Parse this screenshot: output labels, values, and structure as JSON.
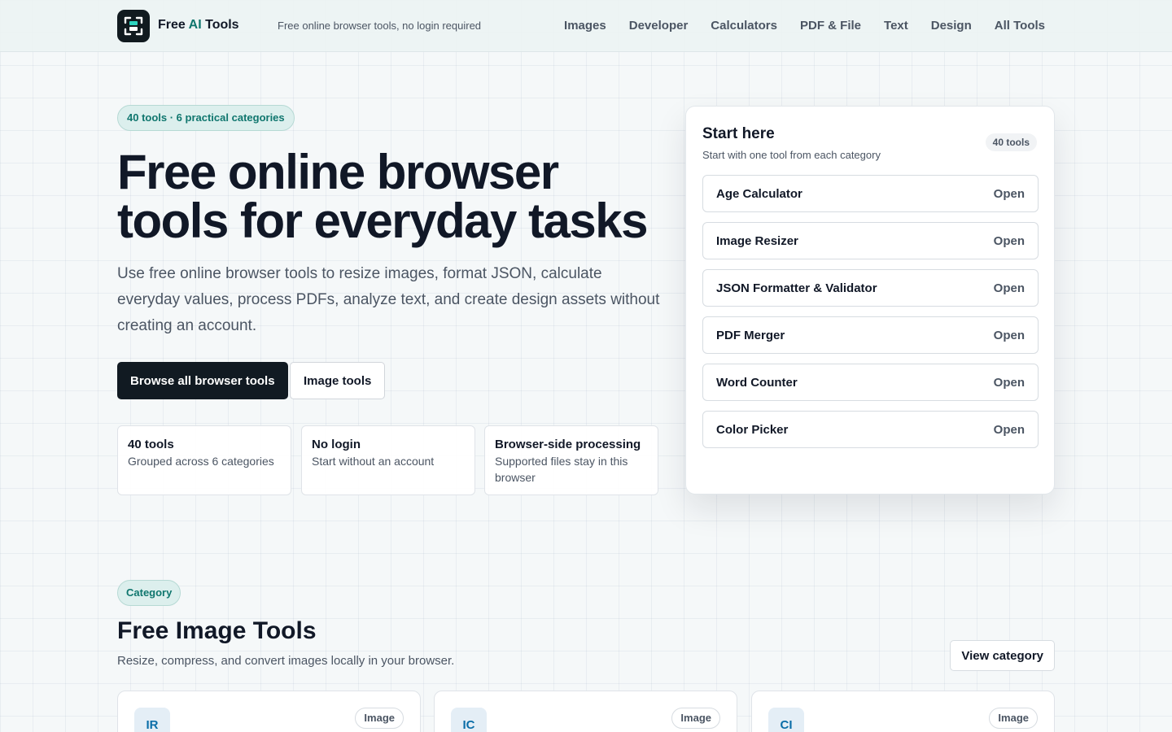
{
  "header": {
    "brand_prefix": "Free ",
    "brand_ai": "AI",
    "brand_suffix": " Tools",
    "tagline": "Free online browser tools, no login required",
    "nav": [
      "Images",
      "Developer",
      "Calculators",
      "PDF & File",
      "Text",
      "Design",
      "All Tools"
    ]
  },
  "hero": {
    "pill": "40 tools · 6 practical categories",
    "title": "Free online browser tools for everyday tasks",
    "description": "Use free online browser tools to resize images, format JSON, calculate everyday values, process PDFs, analyze text, and create design assets without creating an account.",
    "primary_button": "Browse all browser tools",
    "secondary_button": "Image tools",
    "features": [
      {
        "title": "40 tools",
        "desc": "Grouped across 6 categories"
      },
      {
        "title": "No login",
        "desc": "Start without an account"
      },
      {
        "title": "Browser-side processing",
        "desc": "Supported files stay in this browser"
      }
    ]
  },
  "start_panel": {
    "title": "Start here",
    "subtitle": "Start with one tool from each category",
    "badge": "40 tools",
    "open_label": "Open",
    "tools": [
      "Age Calculator",
      "Image Resizer",
      "JSON Formatter & Validator",
      "PDF Merger",
      "Word Counter",
      "Color Picker"
    ]
  },
  "category": {
    "pill": "Category",
    "title": "Free Image Tools",
    "description": "Resize, compress, and convert images locally in your browser.",
    "view_button": "View category",
    "cards": [
      {
        "abbr": "IR",
        "tag": "Image"
      },
      {
        "abbr": "IC",
        "tag": "Image"
      },
      {
        "abbr": "CI",
        "tag": "Image"
      }
    ]
  },
  "colors": {
    "accent": "#0f766e",
    "primary_button": "#111a22",
    "card_abbr": "#0b6ea8"
  }
}
